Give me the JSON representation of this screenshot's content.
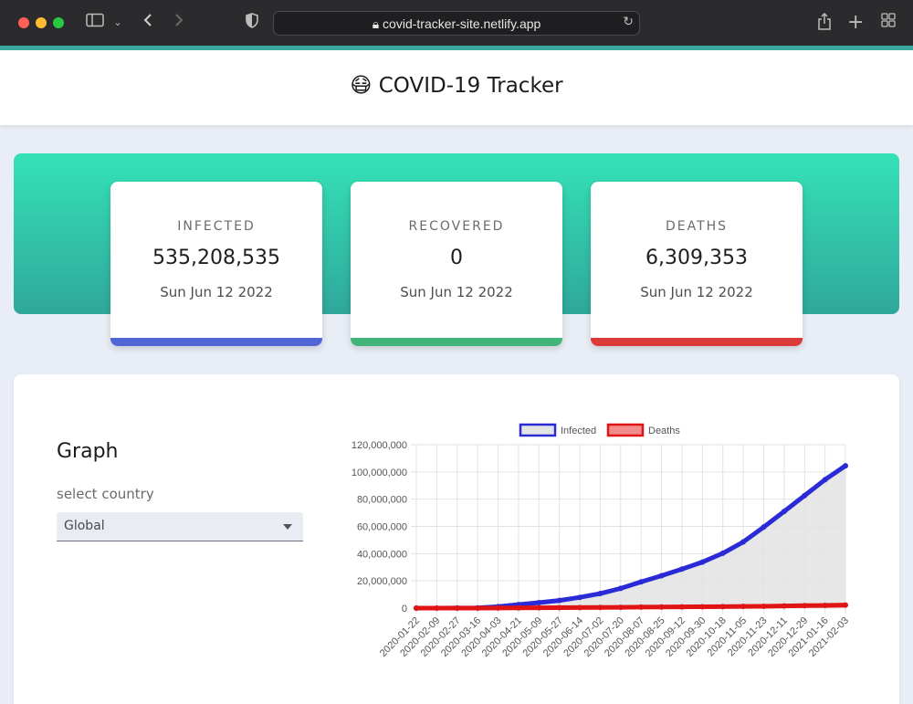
{
  "browser": {
    "url": "covid-tracker-site.netlify.app"
  },
  "header": {
    "icon": "😷",
    "title": "COVID-19 Tracker"
  },
  "stats": [
    {
      "label": "INFECTED",
      "value": "535,208,535",
      "date": "Sun Jun 12 2022",
      "color": "#5065d6"
    },
    {
      "label": "RECOVERED",
      "value": "0",
      "date": "Sun Jun 12 2022",
      "color": "#43b57a"
    },
    {
      "label": "DEATHS",
      "value": "6,309,353",
      "date": "Sun Jun 12 2022",
      "color": "#dc3a3a"
    }
  ],
  "graph": {
    "title": "Graph",
    "select_label": "select country",
    "selected_country": "Global"
  },
  "chart_data": {
    "type": "line",
    "x": [
      "2020-01-22",
      "2020-02-09",
      "2020-02-27",
      "2020-03-16",
      "2020-04-03",
      "2020-04-21",
      "2020-05-09",
      "2020-05-27",
      "2020-06-14",
      "2020-07-02",
      "2020-07-20",
      "2020-08-07",
      "2020-08-25",
      "2020-09-12",
      "2020-09-30",
      "2020-10-18",
      "2020-11-05",
      "2020-11-23",
      "2020-12-11",
      "2020-12-29",
      "2021-01-16",
      "2021-02-03"
    ],
    "series": [
      {
        "name": "Infected",
        "color": "#2a2ad6",
        "fill": "#e3e3e3",
        "values": [
          555,
          40000,
          84000,
          180000,
          1100000,
          2600000,
          4000000,
          5600000,
          7900000,
          10700000,
          14500000,
          19300000,
          23800000,
          28700000,
          33800000,
          40300000,
          48600000,
          59500000,
          71000000,
          82600000,
          94300000,
          104500000
        ]
      },
      {
        "name": "Deaths",
        "color": "#e01414",
        "fill": "#f28b8b",
        "values": [
          17,
          900,
          2800,
          7500,
          59000,
          170000,
          280000,
          350000,
          430000,
          520000,
          600000,
          715000,
          810000,
          915000,
          1010000,
          1110000,
          1230000,
          1380000,
          1590000,
          1810000,
          2020000,
          2250000
        ]
      }
    ],
    "ylim": [
      0,
      120000000
    ],
    "yticks": [
      "0",
      "20,000,000",
      "40,000,000",
      "60,000,000",
      "80,000,000",
      "100,000,000",
      "120,000,000"
    ],
    "grid": true,
    "legend": "top-center"
  }
}
